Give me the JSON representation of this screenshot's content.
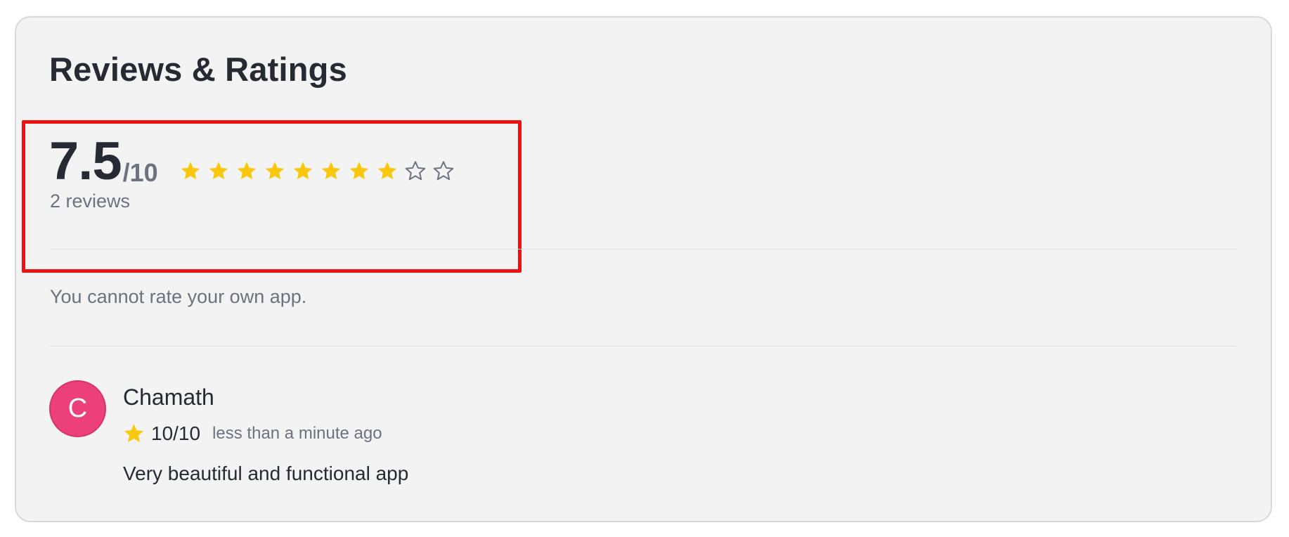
{
  "section": {
    "title": "Reviews & Ratings"
  },
  "summary": {
    "score": "7.5",
    "max": "/10",
    "review_count": "2 reviews",
    "star_rating": 7.5,
    "star_total": 10,
    "filled_stars": 8,
    "empty_stars": 2
  },
  "notice": "You cannot rate your own app.",
  "reviews": [
    {
      "avatar_initial": "C",
      "name": "Chamath",
      "score": "10/10",
      "time": "less than a minute ago",
      "text": "Very beautiful and functional app"
    }
  ],
  "colors": {
    "star_filled": "#f9c80e",
    "star_empty_outline": "#6b7280",
    "avatar_bg": "#ec407a",
    "highlight_border": "#ee1111"
  },
  "icons": {
    "filled_star": "star-filled-icon",
    "empty_star": "star-empty-icon"
  }
}
